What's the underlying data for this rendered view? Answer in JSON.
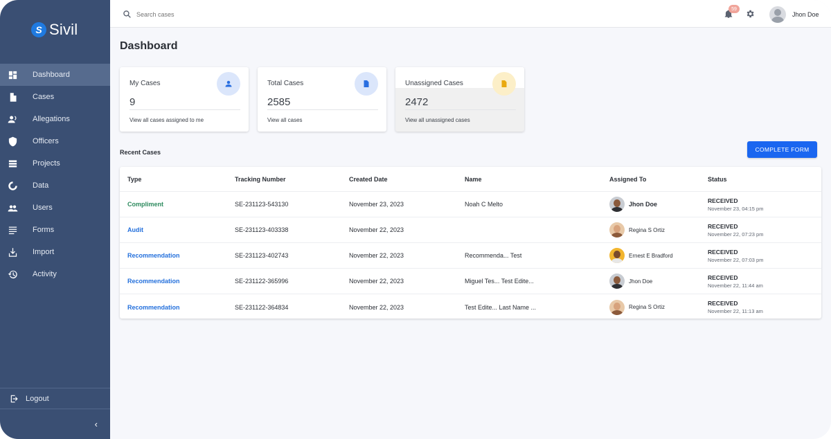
{
  "app": {
    "name": "Sivil",
    "logo_letter": "S"
  },
  "sidebar": {
    "items": [
      {
        "label": "Dashboard",
        "icon": "dashboard-icon",
        "active": true
      },
      {
        "label": "Cases",
        "icon": "file-icon"
      },
      {
        "label": "Allegations",
        "icon": "report-person-icon"
      },
      {
        "label": "Officers",
        "icon": "shield-icon"
      },
      {
        "label": "Projects",
        "icon": "list-icon"
      },
      {
        "label": "Data",
        "icon": "donut-chart-icon"
      },
      {
        "label": "Users",
        "icon": "users-icon"
      },
      {
        "label": "Forms",
        "icon": "form-lines-icon"
      },
      {
        "label": "Import",
        "icon": "import-icon"
      },
      {
        "label": "Activity",
        "icon": "history-icon"
      }
    ],
    "logout_label": "Logout",
    "collapse_glyph": "‹"
  },
  "topbar": {
    "search_placeholder": "Search cases",
    "notification_count": "59",
    "user_name": "Jhon Doe"
  },
  "page": {
    "title": "Dashboard"
  },
  "cards": [
    {
      "label": "My Cases",
      "value": "9",
      "link": "View all cases assigned to me",
      "icon": "person-icon",
      "icon_bg": "#dbe6fb",
      "icon_color": "#2a6fe0"
    },
    {
      "label": "Total Cases",
      "value": "2585",
      "link": "View all cases",
      "icon": "document-icon",
      "icon_bg": "#dbe6fb",
      "icon_color": "#2a6fe0"
    },
    {
      "label": "Unassigned Cases",
      "value": "2472",
      "link": "View all unassigned cases",
      "icon": "download-file-icon",
      "icon_bg": "#fcefc8",
      "icon_color": "#e9a90f"
    }
  ],
  "recent": {
    "title": "Recent Cases",
    "button_label": "COMPLETE FORM",
    "columns": [
      "Type",
      "Tracking Number",
      "Created Date",
      "Name",
      "Assigned To",
      "Status"
    ],
    "rows": [
      {
        "type": "Compliment",
        "tracking": "SE-231123-543130",
        "created": "November 23, 2023",
        "name": "Noah C Melto",
        "assigned": "Jhon Doe",
        "status": "RECEIVED",
        "status_time": "November 23, 04:15 pm"
      },
      {
        "type": "Audit",
        "tracking": "SE-231123-403338",
        "created": "November 22, 2023",
        "name": "",
        "assigned": "Regina S Ortiz",
        "status": "RECEIVED",
        "status_time": "November 22, 07:23 pm"
      },
      {
        "type": "Recommendation",
        "tracking": "SE-231123-402743",
        "created": "November 22, 2023",
        "name": "Recommenda... Test",
        "assigned": "Ernest E Bradford",
        "status": "RECEIVED",
        "status_time": "November 22, 07:03 pm"
      },
      {
        "type": "Recommendation",
        "tracking": "SE-231122-365996",
        "created": "November 22, 2023",
        "name": "Miguel Tes... Test Edite...",
        "assigned": "Jhon Doe",
        "status": "RECEIVED",
        "status_time": "November 22, 11:44 am"
      },
      {
        "type": "Recommendation",
        "tracking": "SE-231122-364834",
        "created": "November 22, 2023",
        "name": "Test Edite... Last Name ...",
        "assigned": "Regina S Ortiz",
        "status": "RECEIVED",
        "status_time": "November 22, 11:13 am"
      }
    ]
  },
  "colors": {
    "sidebar": "#3a4f73",
    "accent": "#1a66f0",
    "compliment": "#2e8b5f",
    "link": "#2470dc"
  }
}
